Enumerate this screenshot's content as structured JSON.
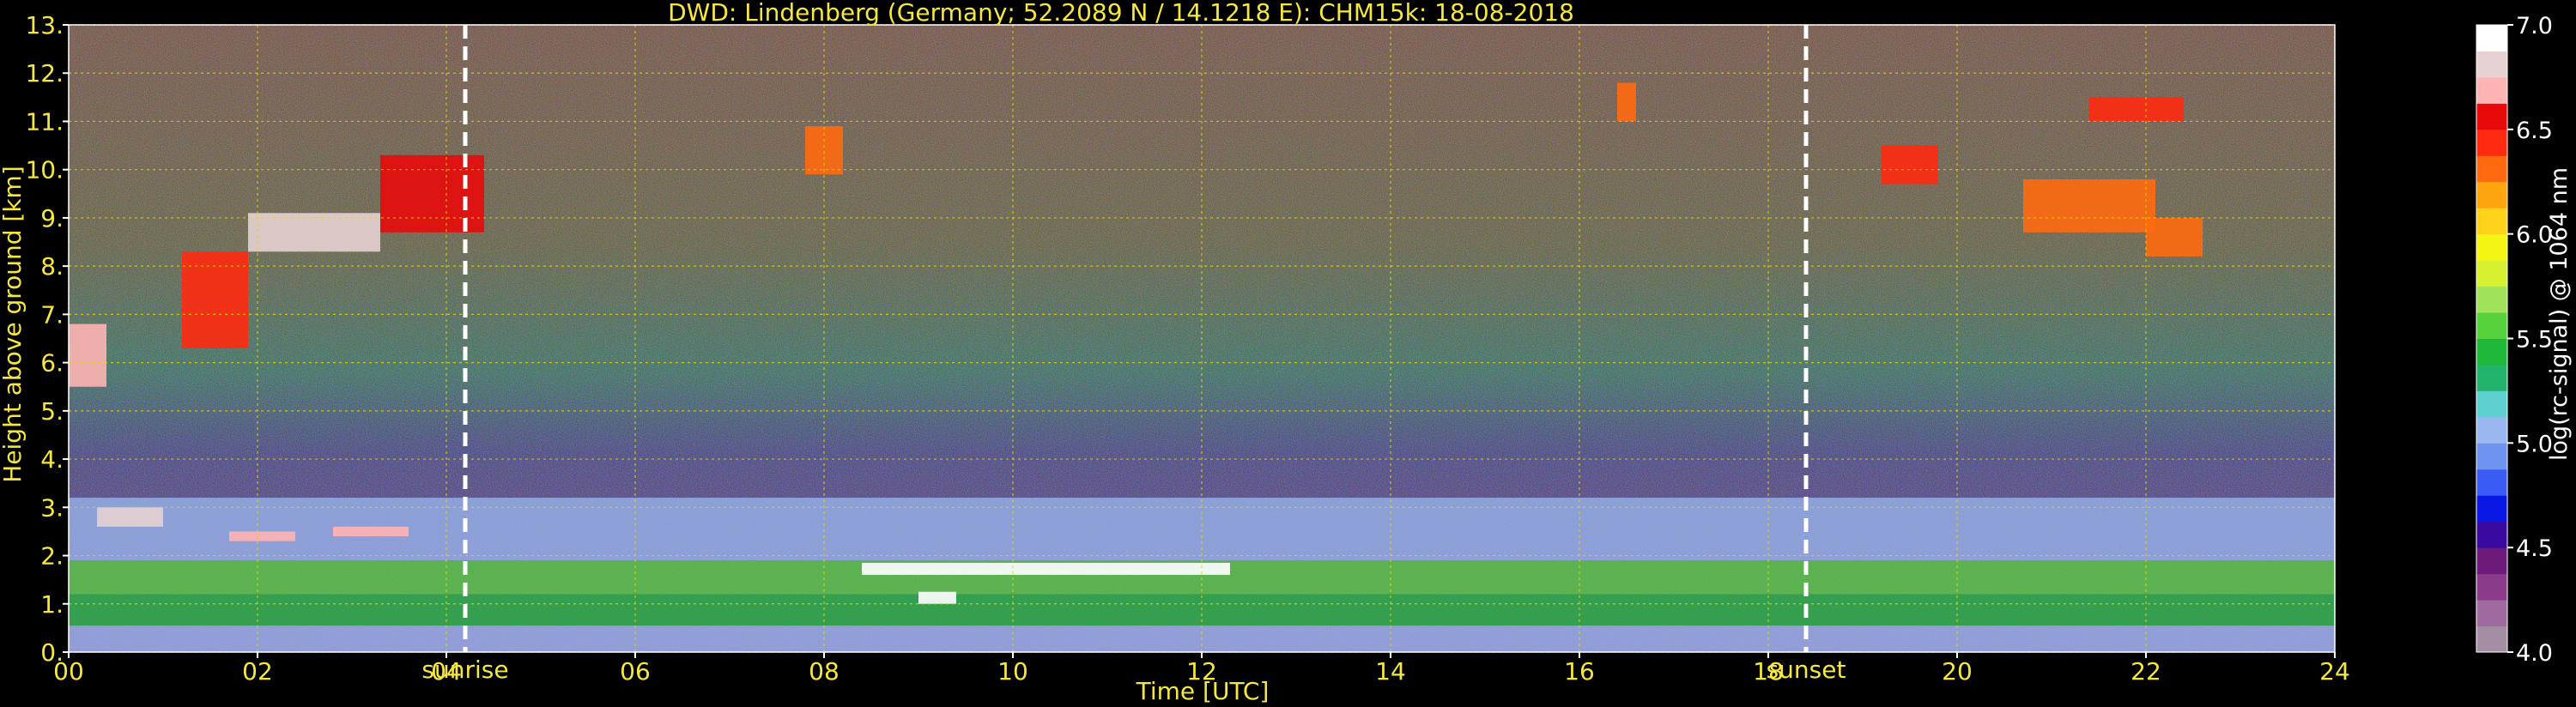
{
  "chart_data": {
    "type": "heatmap",
    "title": "DWD: Lindenberg (Germany; 52.2089 N / 14.1218 E):    CHM15k: 18-08-2018",
    "xlabel": "Time [UTC]",
    "ylabel": "Height above ground [km]",
    "xlim": [
      0,
      24
    ],
    "ylim": [
      0,
      13
    ],
    "x_ticks": [
      0,
      2,
      4,
      6,
      8,
      10,
      12,
      14,
      16,
      18,
      20,
      22,
      24
    ],
    "x_tick_labels": [
      "00",
      "02",
      "04",
      "06",
      "08",
      "10",
      "12",
      "14",
      "16",
      "18",
      "20",
      "22",
      "24"
    ],
    "y_ticks": [
      0,
      1,
      2,
      3,
      4,
      5,
      6,
      7,
      8,
      9,
      10,
      11,
      12,
      13
    ],
    "y_tick_labels": [
      "0.",
      "1.",
      "2.",
      "3.",
      "4.",
      "5.",
      "6.",
      "7.",
      "8.",
      "9.",
      "10.",
      "11.",
      "12.",
      "13."
    ],
    "grid": true,
    "annotations": [
      {
        "label": "sunrise",
        "x": 4.2
      },
      {
        "label": "sunset",
        "x": 18.4
      }
    ],
    "colorbar": {
      "label": "log(rc-signal) @ 1064 nm",
      "range": [
        4.0,
        7.0
      ],
      "ticks": [
        4.0,
        4.5,
        5.0,
        5.5,
        6.0,
        6.5,
        7.0
      ],
      "tick_labels": [
        "4.0",
        "4.5",
        "5.0",
        "5.5",
        "6.0",
        "6.5",
        "7.0"
      ],
      "colors": [
        "#a38ea3",
        "#9f6a9f",
        "#8a3c8a",
        "#6d1a7a",
        "#3a0aa0",
        "#0a18e6",
        "#3a5cf5",
        "#6f93f0",
        "#9ab8ef",
        "#5fd0d0",
        "#23b46b",
        "#1fb83a",
        "#55d23c",
        "#a0e35a",
        "#d7f030",
        "#f5f514",
        "#ffd21c",
        "#ffa510",
        "#ff6a10",
        "#ff2a10",
        "#e80a0a",
        "#ffb4b4",
        "#e6d2d2",
        "#ffffff"
      ]
    },
    "layers": [
      {
        "name": "boundary-layer-base",
        "x_start": 0,
        "x_end": 24,
        "y_bottom": 0.0,
        "y_top": 0.55,
        "level": 5.1
      },
      {
        "name": "residual-layer",
        "x_start": 0,
        "x_end": 24,
        "y_bottom": 0.55,
        "y_top": 1.2,
        "level": 5.4
      },
      {
        "name": "aerosol-layer",
        "x_start": 0,
        "x_end": 24,
        "y_bottom": 1.2,
        "y_top": 1.9,
        "level": 5.6
      },
      {
        "name": "mixed-upper",
        "x_start": 0,
        "x_end": 24,
        "y_bottom": 1.9,
        "y_top": 3.2,
        "level": 5.0
      }
    ],
    "clouds": [
      {
        "x_start": 0.0,
        "x_end": 0.4,
        "y_bottom": 5.5,
        "y_top": 6.8,
        "level": 6.8
      },
      {
        "x_start": 1.2,
        "x_end": 1.9,
        "y_bottom": 6.3,
        "y_top": 8.3,
        "level": 6.5
      },
      {
        "x_start": 1.9,
        "x_end": 3.3,
        "y_bottom": 8.3,
        "y_top": 9.1,
        "level": 6.9
      },
      {
        "x_start": 3.3,
        "x_end": 4.4,
        "y_bottom": 8.7,
        "y_top": 10.3,
        "level": 6.6
      },
      {
        "x_start": 0.3,
        "x_end": 1.0,
        "y_bottom": 2.6,
        "y_top": 3.0,
        "level": 6.9
      },
      {
        "x_start": 1.7,
        "x_end": 2.4,
        "y_bottom": 2.3,
        "y_top": 2.5,
        "level": 6.8
      },
      {
        "x_start": 2.8,
        "x_end": 3.6,
        "y_bottom": 2.4,
        "y_top": 2.6,
        "level": 6.7
      },
      {
        "x_start": 8.4,
        "x_end": 12.3,
        "y_bottom": 1.6,
        "y_top": 1.85,
        "level": 7.0
      },
      {
        "x_start": 9.0,
        "x_end": 9.4,
        "y_bottom": 1.0,
        "y_top": 1.25,
        "level": 7.0
      },
      {
        "x_start": 7.8,
        "x_end": 8.2,
        "y_bottom": 9.9,
        "y_top": 10.9,
        "level": 6.4
      },
      {
        "x_start": 16.4,
        "x_end": 16.6,
        "y_bottom": 11.0,
        "y_top": 11.8,
        "level": 6.4
      },
      {
        "x_start": 19.2,
        "x_end": 19.8,
        "y_bottom": 9.7,
        "y_top": 10.5,
        "level": 6.5
      },
      {
        "x_start": 20.7,
        "x_end": 22.1,
        "y_bottom": 8.7,
        "y_top": 9.8,
        "level": 6.4
      },
      {
        "x_start": 21.4,
        "x_end": 22.4,
        "y_bottom": 11.0,
        "y_top": 11.5,
        "level": 6.5
      },
      {
        "x_start": 22.0,
        "x_end": 22.6,
        "y_bottom": 8.2,
        "y_top": 9.0,
        "level": 6.3
      }
    ]
  }
}
